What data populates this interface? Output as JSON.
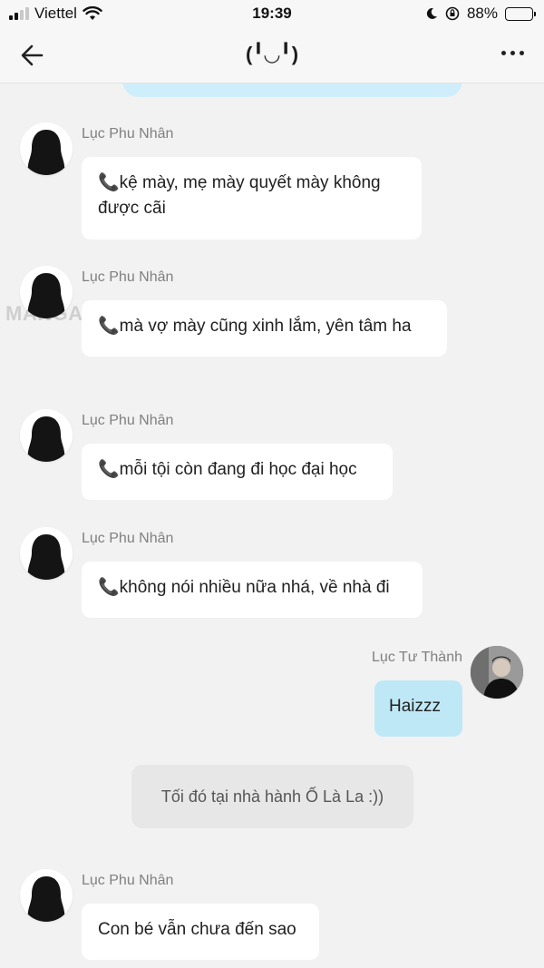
{
  "status_bar": {
    "carrier": "Viettel",
    "time": "19:39",
    "battery_percent": "88%"
  },
  "header": {
    "title": "(╹◡╹)"
  },
  "messages": [
    {
      "sender": "Lục Phu Nhân",
      "text_line1": "kệ mày, mẹ mày quyết mày không",
      "text_line2": "được cãi"
    },
    {
      "sender": "Lục Phu Nhân",
      "text": "mà vợ mày cũng xinh lắm, yên tâm ha"
    },
    {
      "sender": "Lục Phu Nhân",
      "text": "mỗi tội còn đang đi học đại học"
    },
    {
      "sender": "Lục Phu Nhân",
      "text": "không nói nhiều nữa nhá, về nhà đi"
    },
    {
      "sender": "Lục Tư Thành",
      "text": "Haizzz"
    },
    {
      "sender": "Lục Phu Nhân",
      "text": "Con bé vẫn chưa đến sao"
    }
  ],
  "narration": "Tối đó tại nhà hành Ố Là La :))",
  "phone_emoji": "📞",
  "watermark": "MANGATOON",
  "colors": {
    "background": "#f2f2f2",
    "incoming_bubble": "#ffffff",
    "outgoing_bubble": "#bfe8f7",
    "narration_bubble": "#e7e7e7"
  }
}
